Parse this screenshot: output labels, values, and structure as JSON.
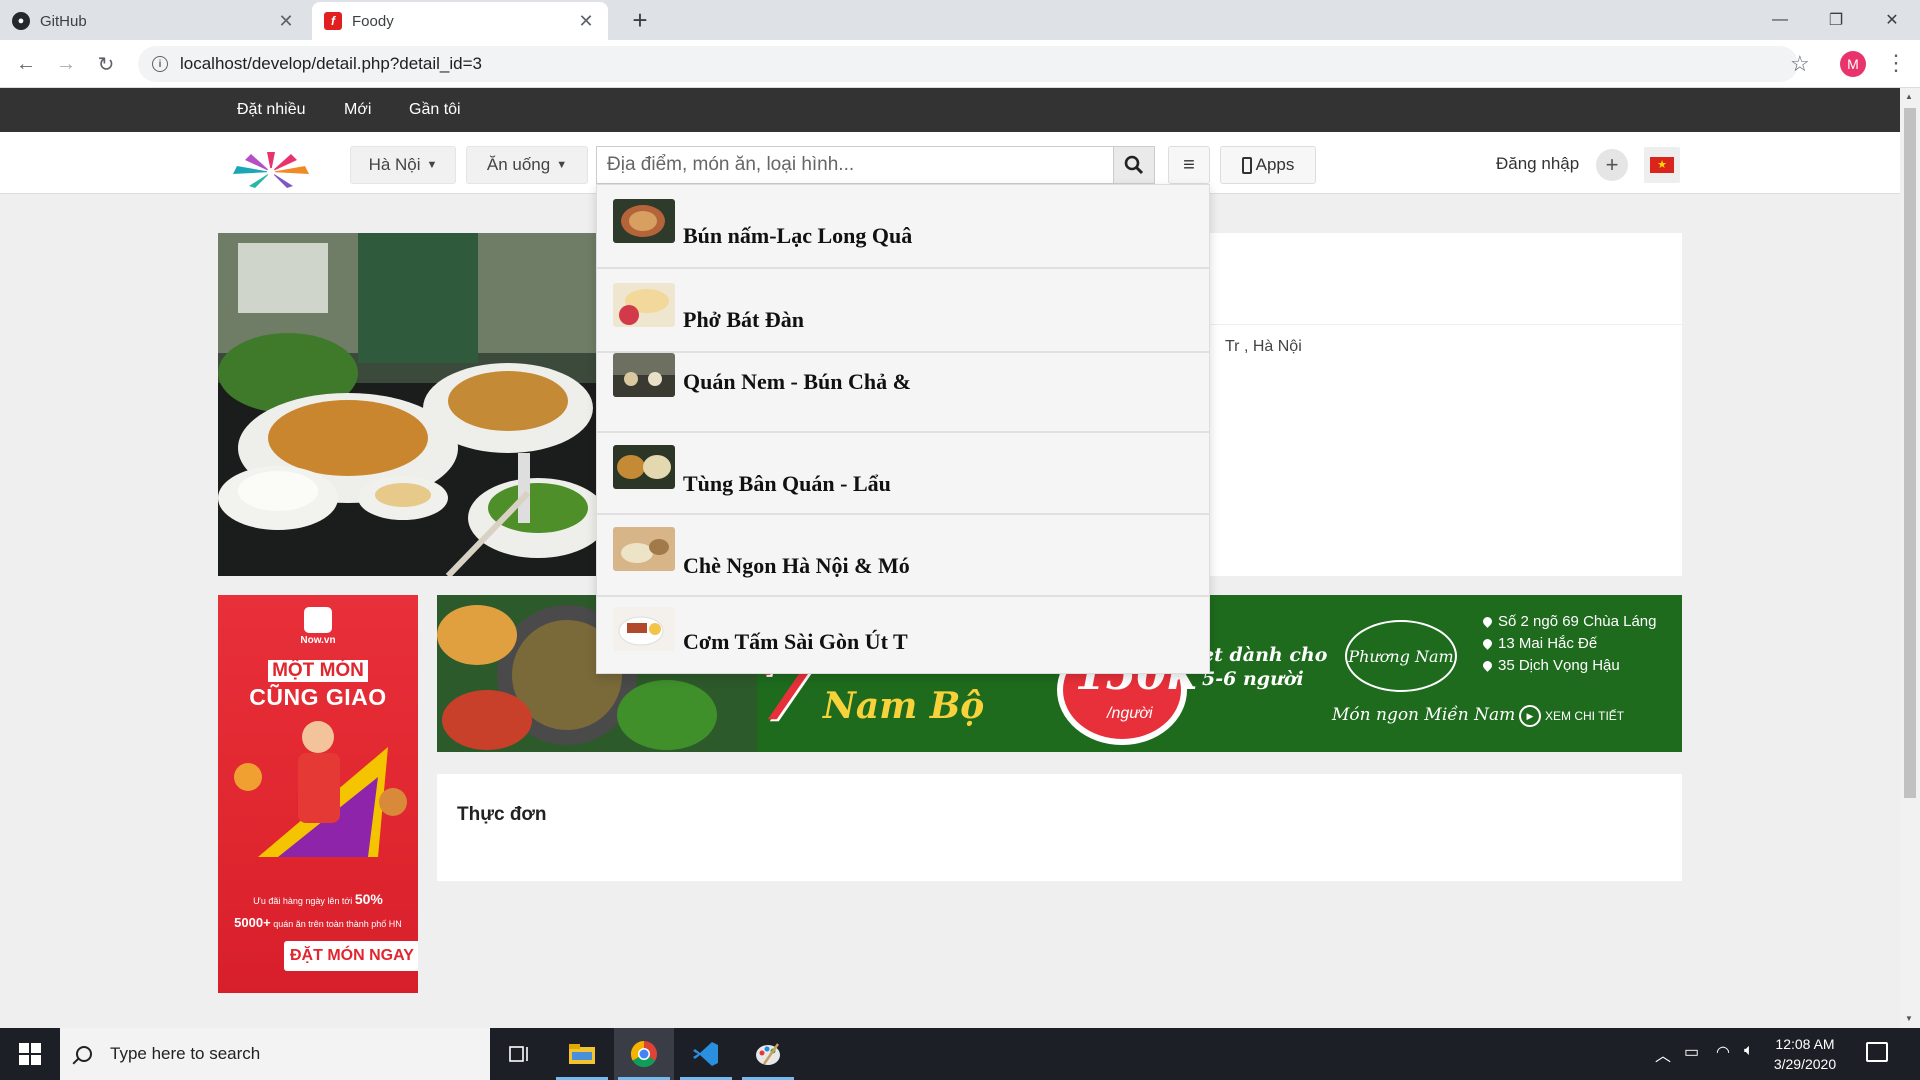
{
  "browser": {
    "tabs": [
      {
        "title": "GitHub",
        "icon": "github-icon"
      },
      {
        "title": "Foody",
        "icon": "foody-icon"
      }
    ],
    "url": "localhost/develop/detail.php?detail_id=3",
    "profile_initial": "M"
  },
  "topnav": {
    "links": [
      "Đặt nhiều",
      "Mới",
      "Gần tôi"
    ]
  },
  "header": {
    "city": "Hà Nội",
    "category": "Ăn uống",
    "search_placeholder": "Địa điểm, món ăn, loại hình...",
    "apps_label": "Apps",
    "login_label": "Đăng nhập",
    "flag_star": "★"
  },
  "detail": {
    "address_suffix": "Tr , Hà Nội"
  },
  "suggestions": [
    {
      "name": "Bún nấm-Lạc Long Quâ"
    },
    {
      "name": "Phở Bát Đàn"
    },
    {
      "name": "Quán Nem - Bún Chả &"
    },
    {
      "name": "Tùng Bân Quán - Lẩu"
    },
    {
      "name": "Chè Ngon Hà Nội & Mó"
    },
    {
      "name": "Cơm Tấm Sài Gòn Út T"
    }
  ],
  "side_banner": {
    "brand": "Now.vn",
    "slogan_line1": "MỘT MÓN",
    "slogan_line2": "CŨNG GIAO",
    "promo1_text": "Ưu đãi hàng ngày lên tới",
    "promo1_value": "50%",
    "promo2_value": "5000+",
    "promo2_text": "quán ăn trên toàn thành phố HN",
    "cta": "ĐẶT MÓN NGAY"
  },
  "wide_banner": {
    "number": "7",
    "title": "Nam Bộ",
    "price": "150k",
    "per": "/người",
    "dinner_line1": "et dành cho",
    "dinner_line2": "5-6 người",
    "logo_text": "Phương Nam",
    "slogan": "Món ngon Miền Nam",
    "addresses": [
      "Số 2 ngõ 69 Chùa Láng",
      "13 Mai Hắc Đế",
      "35 Dịch Vọng Hậu"
    ],
    "more": "XEM CHI TIẾT"
  },
  "menu_section": {
    "title": "Thực đơn"
  },
  "taskbar": {
    "search_placeholder": "Type here to search",
    "time": "12:08 AM",
    "date": "3/29/2020"
  }
}
